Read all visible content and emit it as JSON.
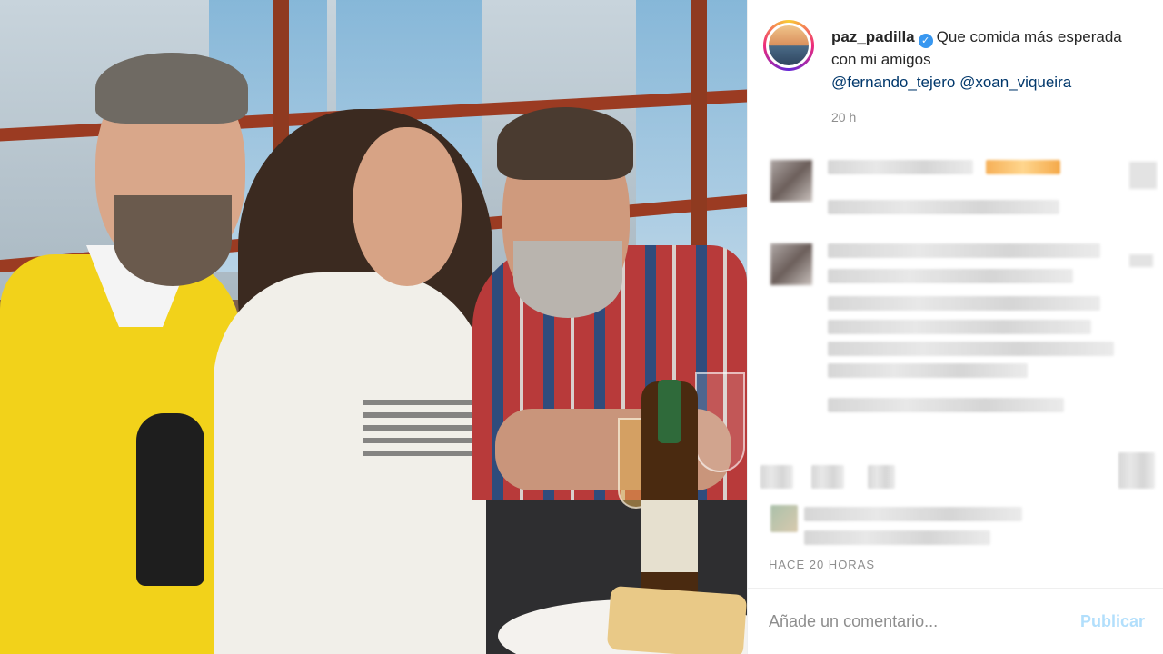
{
  "post": {
    "username": "paz_padilla",
    "verified_icon": "verified-badge-icon",
    "caption_text": "Que comida más esperada con mi amigos",
    "mentions": [
      "@fernando_tejero",
      "@xoan_viqueira"
    ],
    "time_ago": "20 h",
    "date_label": "HACE 20 HORAS"
  },
  "comment_box": {
    "placeholder": "Añade un comentario...",
    "publish_label": "Publicar"
  },
  "colors": {
    "link": "#00376b",
    "verified": "#3897f0",
    "publish_disabled": "#b2dffc",
    "muted": "#8e8e8e"
  }
}
